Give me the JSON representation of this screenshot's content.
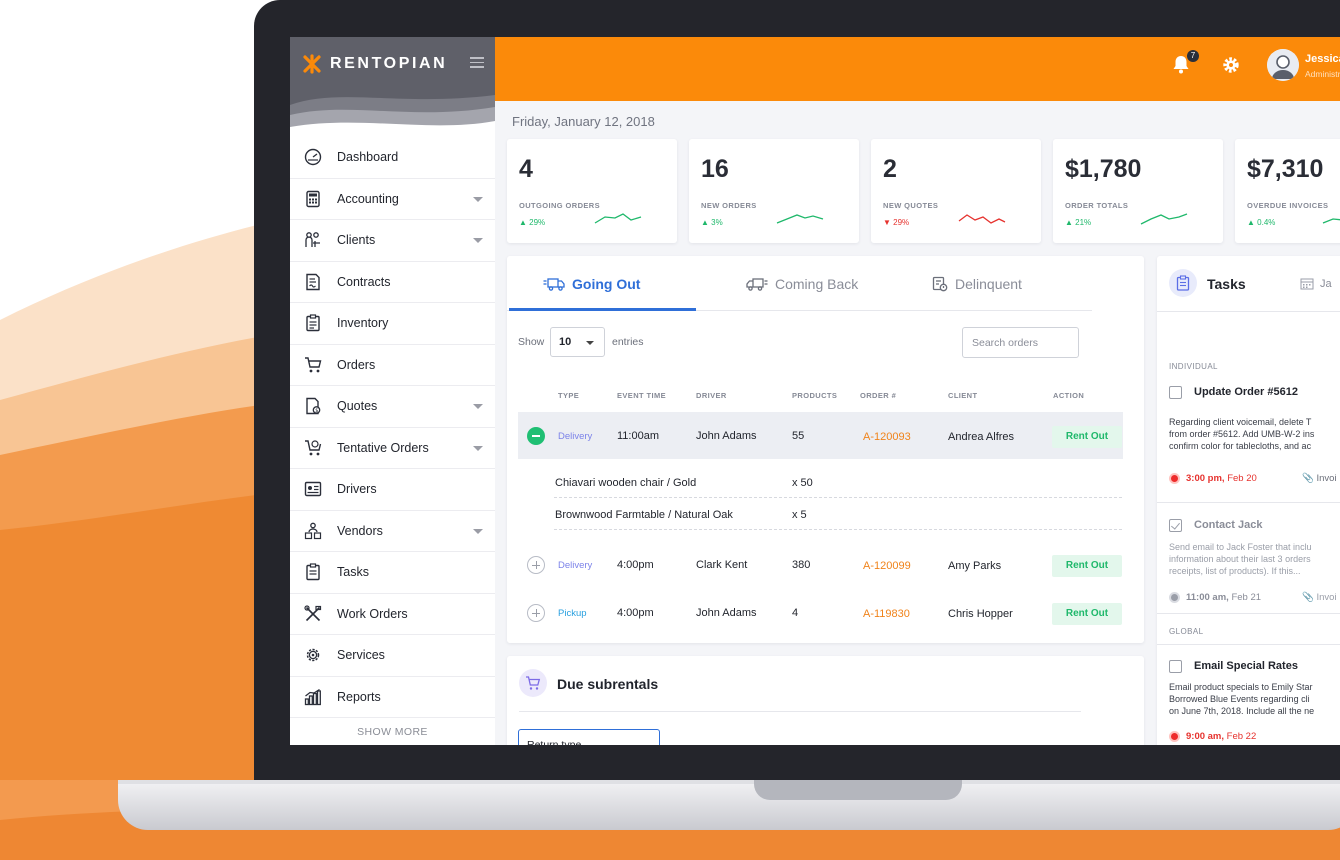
{
  "app": {
    "brand": "RENTOPIAN",
    "colors": {
      "accent": "#fb8a0a",
      "primary": "#2f6fd8",
      "success": "#1fb86b",
      "danger": "#e6322e",
      "sidebar_header": "#5f6069"
    }
  },
  "sidebar": {
    "items": [
      {
        "label": "Dashboard",
        "icon": "dashboard-icon",
        "has_caret": false
      },
      {
        "label": "Accounting",
        "icon": "calculator-icon",
        "has_caret": true
      },
      {
        "label": "Clients",
        "icon": "clients-icon",
        "has_caret": true
      },
      {
        "label": "Contracts",
        "icon": "contract-icon",
        "has_caret": false
      },
      {
        "label": "Inventory",
        "icon": "inventory-icon",
        "has_caret": false
      },
      {
        "label": "Orders",
        "icon": "cart-icon",
        "has_caret": false
      },
      {
        "label": "Quotes",
        "icon": "quote-icon",
        "has_caret": true
      },
      {
        "label": "Tentative Orders",
        "icon": "tentative-cart-icon",
        "has_caret": true
      },
      {
        "label": "Drivers",
        "icon": "driver-icon",
        "has_caret": false
      },
      {
        "label": "Vendors",
        "icon": "vendors-icon",
        "has_caret": true
      },
      {
        "label": "Tasks",
        "icon": "tasks-icon",
        "has_caret": false
      },
      {
        "label": "Work Orders",
        "icon": "tools-icon",
        "has_caret": false
      },
      {
        "label": "Services",
        "icon": "services-gear-icon",
        "has_caret": false
      },
      {
        "label": "Reports",
        "icon": "reports-chart-icon",
        "has_caret": false
      }
    ],
    "show_more": "SHOW MORE"
  },
  "topbar": {
    "notification_count": "7",
    "user_name": "Jessica",
    "user_role": "Administrator"
  },
  "date": "Friday, January 12, 2018",
  "stats": [
    {
      "value": "4",
      "label": "OUTGOING ORDERS",
      "change": "▲ 29%",
      "trend": "up"
    },
    {
      "value": "16",
      "label": "NEW ORDERS",
      "change": "▲ 3%",
      "trend": "up"
    },
    {
      "value": "2",
      "label": "NEW QUOTES",
      "change": "▼ 29%",
      "trend": "down"
    },
    {
      "value": "$1,780",
      "label": "ORDER TOTALS",
      "change": "▲ 21%",
      "trend": "up"
    },
    {
      "value": "$7,310",
      "label": "OVERDUE INVOICES",
      "change": "▲ 0.4%",
      "trend": "up"
    }
  ],
  "orders": {
    "tabs": [
      "Going Out",
      "Coming Back",
      "Delinquent"
    ],
    "show_label": "Show",
    "entries_value": "10",
    "entries_label": "entries",
    "search_placeholder": "Search orders",
    "columns": [
      "TYPE",
      "EVENT TIME",
      "DRIVER",
      "PRODUCTS",
      "ORDER #",
      "CLIENT",
      "ACTION"
    ],
    "rows": [
      {
        "type": "Delivery",
        "time": "11:00am",
        "driver": "John Adams",
        "products": "55",
        "order": "A-120093",
        "client": "Andrea Alfres",
        "action": "Rent Out",
        "expanded": true
      },
      {
        "type": "Delivery",
        "time": "4:00pm",
        "driver": "Clark Kent",
        "products": "380",
        "order": "A-120099",
        "client": "Amy Parks",
        "action": "Rent Out",
        "expanded": false
      },
      {
        "type": "Pickup",
        "time": "4:00pm",
        "driver": "John Adams",
        "products": "4",
        "order": "A-119830",
        "client": "Chris Hopper",
        "action": "Rent Out",
        "expanded": false
      }
    ],
    "sub_items": [
      {
        "name": "Chiavari wooden chair / Gold",
        "qty": "x 50"
      },
      {
        "name": "Brownwood Farmtable / Natural Oak",
        "qty": "x 5"
      }
    ]
  },
  "subrentals": {
    "title": "Due subrentals",
    "select_label": "Return type"
  },
  "tasks": {
    "title": "Tasks",
    "calendar_label": "Ja",
    "individual_label": "INDIVIDUAL",
    "global_label": "GLOBAL",
    "items": [
      {
        "title": "Update Order #5612",
        "desc": [
          "Regarding client voicemail, delete T",
          "from order #5612. Add UMB-W-2 ins",
          "confirm color for tablecloths, and ac"
        ],
        "time": "3:00 pm,",
        "date": "Feb 20",
        "attachment": "Invoi"
      },
      {
        "title": "Contact Jack",
        "desc": [
          "Send email to Jack Foster that inclu",
          "information about their last 3 orders",
          "receipts, list of products). If this..."
        ],
        "time": "11:00 am,",
        "date": "Feb 21",
        "attachment": "Invoi"
      },
      {
        "title": "Email Special Rates",
        "desc": [
          "Email product specials to Emily Star",
          "Borrowed Blue Events regarding cli",
          "on June 7th, 2018. Include all the ne"
        ],
        "time": "9:00 am,",
        "date": "Feb 22",
        "attachment": ""
      }
    ]
  }
}
